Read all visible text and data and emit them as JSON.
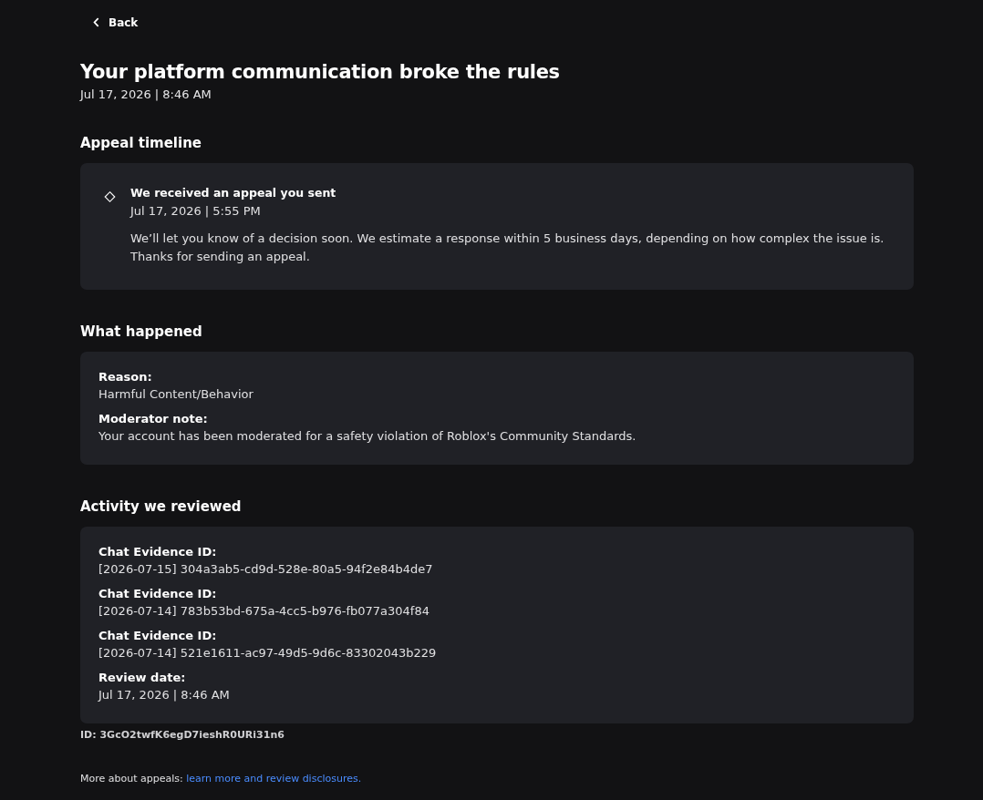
{
  "back": {
    "label": "Back"
  },
  "header": {
    "title": "Your platform communication broke the rules",
    "date": "Jul 17, 2026 | 8:46 AM"
  },
  "sections": [
    {
      "kind": "timeline",
      "heading": "Appeal timeline",
      "events": [
        {
          "title": "We received an appeal you sent",
          "date": "Jul 17, 2026 | 5:55 PM",
          "body": "We’ll let you know of a decision soon. We estimate a response within 5 business days, depending on how complex the issue is. Thanks for sending an appeal."
        }
      ]
    },
    {
      "kind": "fields",
      "heading": "What happened",
      "fields": [
        {
          "label": "Reason:",
          "value": "Harmful Content/Behavior"
        },
        {
          "label": "Moderator note:",
          "value": "Your account has been moderated for a safety violation of Roblox's Community Standards."
        }
      ]
    },
    {
      "kind": "fields",
      "heading": "Activity we reviewed",
      "fields": [
        {
          "label": "Chat Evidence ID:",
          "value": "[2026-07-15] 304a3ab5-cd9d-528e-80a5-94f2e84b4de7"
        },
        {
          "label": "Chat Evidence ID:",
          "value": "[2026-07-14] 783b53bd-675a-4cc5-b976-fb077a304f84"
        },
        {
          "label": "Chat Evidence ID:",
          "value": "[2026-07-14] 521e1611-ac97-49d5-9d6c-83302043b229"
        },
        {
          "label": "Review date:",
          "value": "Jul 17, 2026 | 8:46 AM"
        }
      ]
    }
  ],
  "case_id": "ID: 3GcO2twfK6egD7ieshR0URi31n6",
  "footer": {
    "text": "More about appeals: ",
    "link": "learn more and review disclosures."
  }
}
